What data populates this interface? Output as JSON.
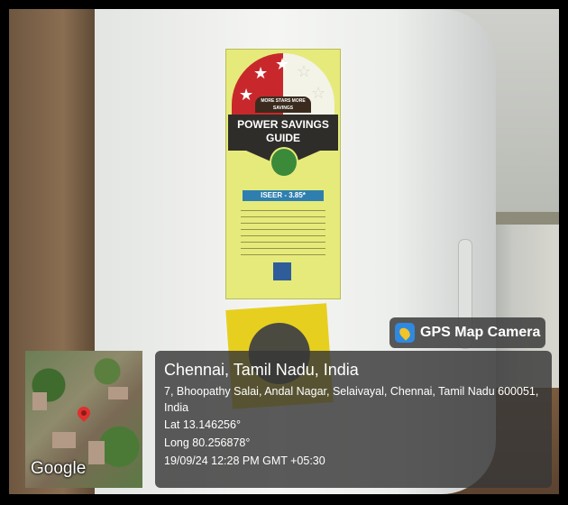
{
  "photo": {
    "energy_label": {
      "top_banner": "MORE STARS MORE SAVINGS",
      "title": "POWER SAVINGS GUIDE",
      "rating": "ISEER - 3.85*",
      "stars_filled": 3,
      "stars_total": 5
    }
  },
  "overlay": {
    "brand_icon": "gps-map-camera-icon",
    "brand_label": "GPS Map Camera",
    "map_watermark": "Google",
    "location_title": "Chennai, Tamil Nadu, India",
    "address": "7, Bhoopathy Salai, Andal Nagar, Selaivayal, Chennai, Tamil Nadu 600051, India",
    "latitude": "Lat 13.146256°",
    "longitude": "Long 80.256878°",
    "timestamp": "19/09/24 12:28 PM GMT +05:30"
  },
  "colors": {
    "overlay_bg": "#373737",
    "pin": "#e0302e",
    "app_icon": "#2f89e0"
  }
}
